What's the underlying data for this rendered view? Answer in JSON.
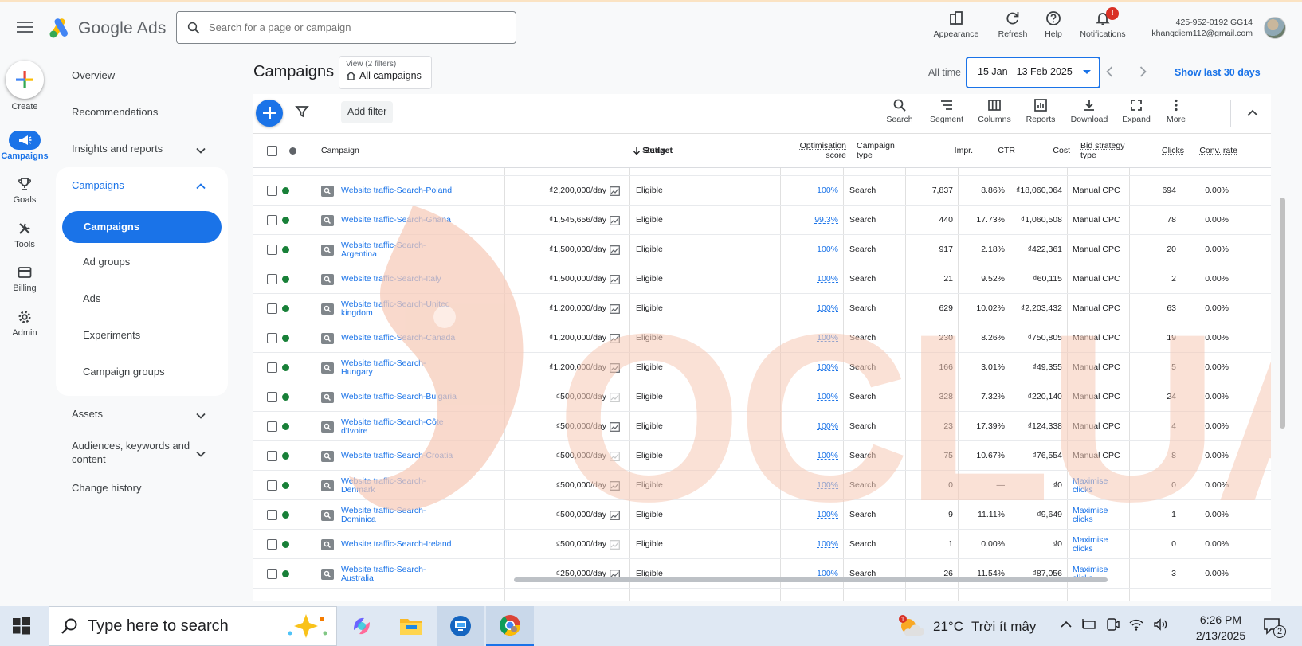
{
  "header": {
    "brand": "Google Ads",
    "search_placeholder": "Search for a page or campaign",
    "tools": [
      "Appearance",
      "Refresh",
      "Help",
      "Notifications"
    ],
    "notification_count": "!",
    "account_id": "425-952-0192 GG14",
    "account_email": "khangdiem112@gmail.com"
  },
  "rail": {
    "create": "Create",
    "items": [
      "Campaigns",
      "Goals",
      "Tools",
      "Billing",
      "Admin"
    ]
  },
  "nav": {
    "overview": "Overview",
    "recommendations": "Recommendations",
    "insights": "Insights and reports",
    "campaigns_group": "Campaigns",
    "campaigns_sub": [
      "Campaigns",
      "Ad groups",
      "Ads",
      "Experiments",
      "Campaign groups"
    ],
    "assets": "Assets",
    "audiences_line1": "Audiences, keywords and",
    "audiences_line2": "content",
    "change_history": "Change history"
  },
  "page": {
    "title": "Campaigns",
    "view_label": "View (2 filters)",
    "view_value": "All campaigns",
    "all_time": "All time",
    "date_range": "15 Jan - 13 Feb 2025",
    "show_last": "Show last 30 days"
  },
  "toolbar": {
    "add_filter": "Add filter",
    "tools": [
      "Search",
      "Segment",
      "Columns",
      "Reports",
      "Download",
      "Expand",
      "More"
    ]
  },
  "table": {
    "headers": {
      "campaign": "Campaign",
      "budget": "Budget",
      "status": "Status",
      "optim1": "Optimisation",
      "optim2": "score",
      "ctype1": "Campaign",
      "ctype2": "type",
      "impr": "Impr.",
      "ctr": "CTR",
      "cost": "Cost",
      "bid1": "Bid strategy",
      "bid2": "type",
      "clicks": "Clicks",
      "conv": "Conv. rate"
    },
    "rows": [
      {
        "n1": "Website traffic-Search-Poland",
        "n2": "",
        "budget": "₫2,200,000/day",
        "status": "Eligible",
        "score": "100%",
        "type": "Search",
        "impr": "7,837",
        "ctr": "8.86%",
        "cost": "₫18,060,064",
        "bid1": "Manual CPC",
        "bid2": "",
        "clicks": "694",
        "conv": "0.00%"
      },
      {
        "n1": "Website traffic-Search-Ghana",
        "n2": "",
        "budget": "₫1,545,656/day",
        "status": "Eligible",
        "score": "99.3%",
        "type": "Search",
        "impr": "440",
        "ctr": "17.73%",
        "cost": "₫1,060,508",
        "bid1": "Manual CPC",
        "bid2": "",
        "clicks": "78",
        "conv": "0.00%"
      },
      {
        "n1": "Website traffic-Search-",
        "n2": "Argentina",
        "budget": "₫1,500,000/day",
        "status": "Eligible",
        "score": "100%",
        "type": "Search",
        "impr": "917",
        "ctr": "2.18%",
        "cost": "₫422,361",
        "bid1": "Manual CPC",
        "bid2": "",
        "clicks": "20",
        "conv": "0.00%"
      },
      {
        "n1": "Website traffic-Search-Italy",
        "n2": "",
        "budget": "₫1,500,000/day",
        "status": "Eligible",
        "score": "100%",
        "type": "Search",
        "impr": "21",
        "ctr": "9.52%",
        "cost": "₫60,115",
        "bid1": "Manual CPC",
        "bid2": "",
        "clicks": "2",
        "conv": "0.00%"
      },
      {
        "n1": "Website traffic-Search-United",
        "n2": "kingdom",
        "budget": "₫1,200,000/day",
        "status": "Eligible",
        "score": "100%",
        "type": "Search",
        "impr": "629",
        "ctr": "10.02%",
        "cost": "₫2,203,432",
        "bid1": "Manual CPC",
        "bid2": "",
        "clicks": "63",
        "conv": "0.00%"
      },
      {
        "n1": "Website traffic-Search-Canada",
        "n2": "",
        "budget": "₫1,200,000/day",
        "status": "Eligible",
        "score": "100%",
        "type": "Search",
        "impr": "230",
        "ctr": "8.26%",
        "cost": "₫750,805",
        "bid1": "Manual CPC",
        "bid2": "",
        "clicks": "19",
        "conv": "0.00%"
      },
      {
        "n1": "Website traffic-Search-",
        "n2": "Hungary",
        "budget": "₫1,200,000/day",
        "status": "Eligible",
        "score": "100%",
        "type": "Search",
        "impr": "166",
        "ctr": "3.01%",
        "cost": "₫49,355",
        "bid1": "Manual CPC",
        "bid2": "",
        "clicks": "5",
        "conv": "0.00%"
      },
      {
        "n1": "Website traffic-Search-Bulgaria",
        "n2": "",
        "budget": "₫500,000/day",
        "status": "Eligible",
        "score": "100%",
        "type": "Search",
        "impr": "328",
        "ctr": "7.32%",
        "cost": "₫220,140",
        "bid1": "Manual CPC",
        "bid2": "",
        "clicks": "24",
        "conv": "0.00%"
      },
      {
        "n1": "Website traffic-Search-Côte",
        "n2": "d'Ivoire",
        "budget": "₫500,000/day",
        "status": "Eligible",
        "score": "100%",
        "type": "Search",
        "impr": "23",
        "ctr": "17.39%",
        "cost": "₫124,338",
        "bid1": "Manual CPC",
        "bid2": "",
        "clicks": "4",
        "conv": "0.00%"
      },
      {
        "n1": "Website traffic-Search-Croatia",
        "n2": "",
        "budget": "₫500,000/day",
        "status": "Eligible",
        "score": "100%",
        "type": "Search",
        "impr": "75",
        "ctr": "10.67%",
        "cost": "₫76,554",
        "bid1": "Manual CPC",
        "bid2": "",
        "clicks": "8",
        "conv": "0.00%"
      },
      {
        "n1": "Website traffic-Search-",
        "n2": "Denmark",
        "budget": "₫500,000/day",
        "status": "Eligible",
        "score": "100%",
        "type": "Search",
        "impr": "0",
        "ctr": "—",
        "cost": "₫0",
        "bid1": "Maximise",
        "bid2": "clicks",
        "clicks": "0",
        "conv": "0.00%"
      },
      {
        "n1": "Website traffic-Search-",
        "n2": "Dominica",
        "budget": "₫500,000/day",
        "status": "Eligible",
        "score": "100%",
        "type": "Search",
        "impr": "9",
        "ctr": "11.11%",
        "cost": "₫9,649",
        "bid1": "Maximise",
        "bid2": "clicks",
        "clicks": "1",
        "conv": "0.00%"
      },
      {
        "n1": "Website traffic-Search-Ireland",
        "n2": "",
        "budget": "₫500,000/day",
        "status": "Eligible",
        "score": "100%",
        "type": "Search",
        "impr": "1",
        "ctr": "0.00%",
        "cost": "₫0",
        "bid1": "Maximise",
        "bid2": "clicks",
        "clicks": "0",
        "conv": "0.00%"
      },
      {
        "n1": "Website traffic-Search-",
        "n2": "Australia",
        "budget": "₫250,000/day",
        "status": "Eligible",
        "score": "100%",
        "type": "Search",
        "impr": "26",
        "ctr": "11.54%",
        "cost": "₫87,056",
        "bid1": "Maximise",
        "bid2": "clicks",
        "clicks": "3",
        "conv": "0.00%"
      }
    ]
  },
  "watermark": "OCLUA",
  "taskbar": {
    "search_placeholder": "Type here to search",
    "weather_temp": "21°C",
    "weather_text": "Trời ít mây",
    "weather_badge": "1",
    "time": "6:26 PM",
    "date": "2/13/2025",
    "notif_count": "2"
  },
  "colors": {
    "accent": "#1a73e8",
    "status_green": "#188038",
    "watermark": "#f6c9b6"
  }
}
